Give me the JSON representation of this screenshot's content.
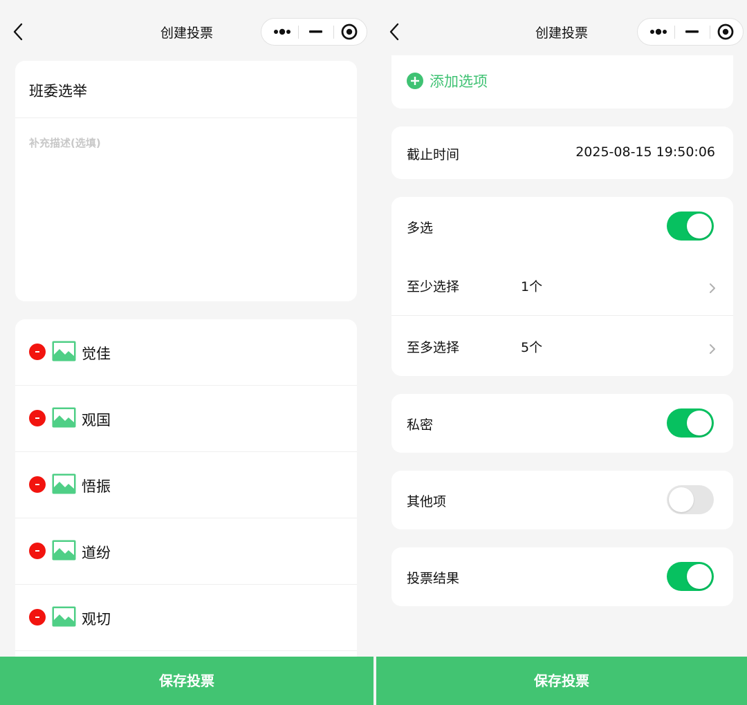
{
  "left": {
    "nav": {
      "title": "创建投票"
    },
    "poll": {
      "title": "班委选举",
      "description_placeholder": "补充描述(选填)"
    },
    "options": [
      {
        "label": "觉佳",
        "remove_icon": "minus-circle-icon",
        "image_icon": "image-icon"
      },
      {
        "label": "观国",
        "remove_icon": "minus-circle-icon",
        "image_icon": "image-icon"
      },
      {
        "label": "悟振",
        "remove_icon": "minus-circle-icon",
        "image_icon": "image-icon"
      },
      {
        "label": "道纷",
        "remove_icon": "minus-circle-icon",
        "image_icon": "image-icon"
      },
      {
        "label": "观切",
        "remove_icon": "minus-circle-icon",
        "image_icon": "image-icon"
      }
    ],
    "save_label": "保存投票"
  },
  "right": {
    "nav": {
      "title": "创建投票"
    },
    "add_option_label": "添加选项",
    "deadline": {
      "label": "截止时间",
      "value": "2025-08-15 19:50:06"
    },
    "multi": {
      "label": "多选",
      "enabled": true,
      "min": {
        "label": "至少选择",
        "value": "1个"
      },
      "max": {
        "label": "至多选择",
        "value": "5个"
      }
    },
    "private": {
      "label": "私密",
      "enabled": true
    },
    "other": {
      "label": "其他项",
      "enabled": false
    },
    "results": {
      "label": "投票结果",
      "enabled": true
    },
    "save_label": "保存投票"
  },
  "colors": {
    "accent_green": "#07c160",
    "save_bar": "#42c472",
    "add_green": "#3fc273",
    "remove_red": "#f2140f",
    "background": "#f5f5f5"
  },
  "icons": [
    "back-arrow-icon",
    "more-dots-icon",
    "minimize-icon",
    "close-target-icon",
    "minus-circle-icon",
    "image-icon",
    "plus-circle-icon",
    "chevron-right-icon"
  ]
}
